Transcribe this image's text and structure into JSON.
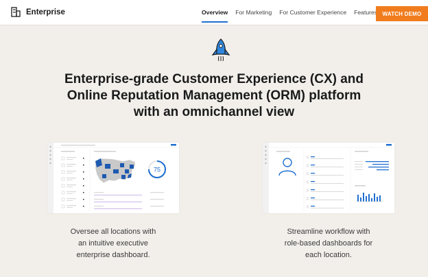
{
  "header": {
    "brand": "Enterprise",
    "nav": [
      "Overview",
      "For Marketing",
      "For Customer Experience",
      "Features"
    ],
    "active_nav": "Overview",
    "cta": "WATCH DEMO"
  },
  "hero": {
    "headline_lines": [
      "Enterprise-grade Customer Experience (CX) and",
      "Online Reputation Management (ORM) platform",
      "with an omnichannel view"
    ]
  },
  "features": [
    {
      "caption_lines": [
        "Oversee all locations with",
        "an intuitive executive",
        "enterprise dashboard."
      ],
      "score": "75"
    },
    {
      "caption_lines": [
        "Streamline workflow with",
        "role-based dashboards for",
        "each location."
      ]
    }
  ],
  "colors": {
    "accent_blue": "#1e6fd0",
    "cta_orange": "#f07c1e",
    "background": "#f2efeb"
  }
}
